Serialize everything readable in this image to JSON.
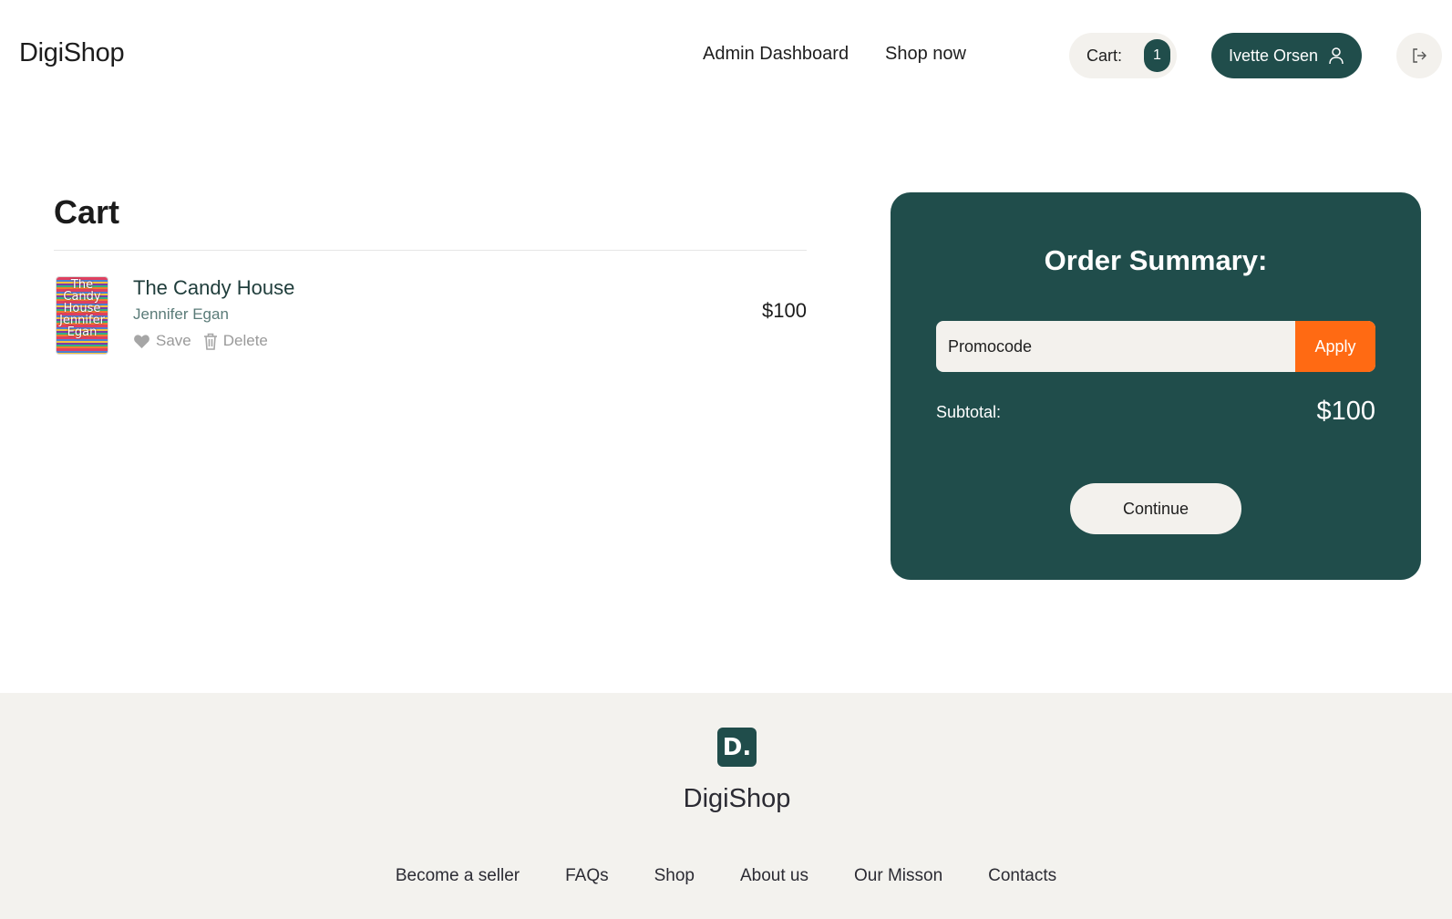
{
  "header": {
    "brand": "DigiShop",
    "nav": {
      "admin_dashboard": "Admin Dashboard",
      "shop_now": "Shop now"
    },
    "cart_label": "Cart:",
    "cart_count": "1",
    "user_name": "Ivette Orsen",
    "icons": {
      "user": "user-icon",
      "logout": "logout-icon"
    }
  },
  "cart": {
    "title": "Cart",
    "items": [
      {
        "title": "The Candy House",
        "author": "Jennifer Egan",
        "price": "$100",
        "cover_text": "The Candy House Jennifer Egan",
        "save_label": "Save",
        "delete_label": "Delete"
      }
    ]
  },
  "summary": {
    "title": "Order Summary:",
    "promo_placeholder": "Promocode",
    "apply_label": "Apply",
    "subtotal_label": "Subtotal:",
    "subtotal_value": "$100",
    "continue_label": "Continue"
  },
  "footer": {
    "logo_letter": "D.",
    "brand": "DigiShop",
    "links": [
      "Become a seller",
      "FAQs",
      "Shop",
      "About us",
      "Our Misson",
      "Contacts"
    ]
  },
  "colors": {
    "primary": "#204d4b",
    "accent": "#ff6a13",
    "light_bg": "#f3f1ed"
  }
}
